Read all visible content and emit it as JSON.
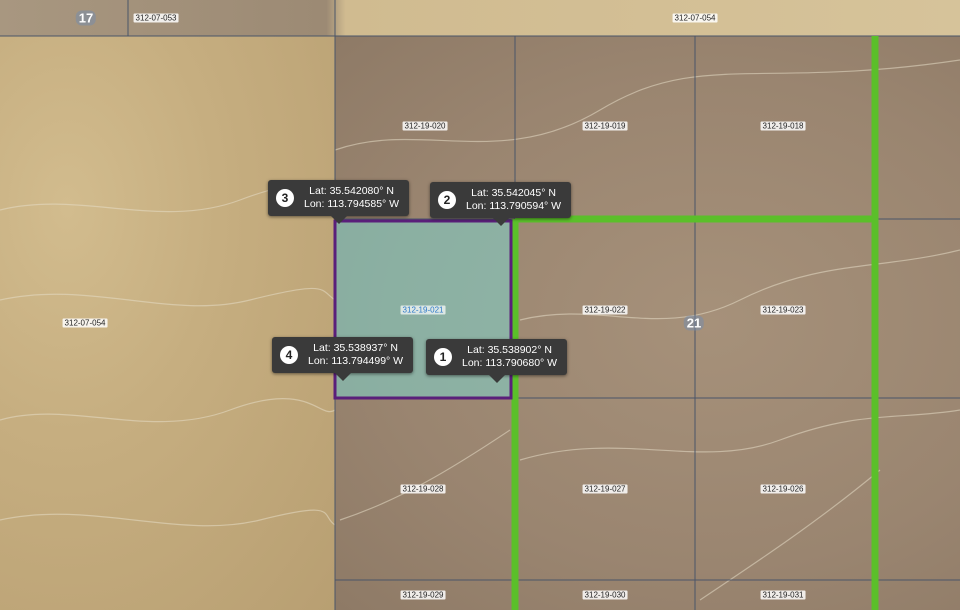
{
  "map": {
    "section_labels": [
      "17",
      "21"
    ],
    "selected_parcel": "312-19-021",
    "parcel_labels": [
      "312-07-053",
      "312-07-054",
      "312-19-020",
      "312-19-019",
      "312-19-018",
      "312-19-021",
      "312-19-022",
      "312-19-023",
      "312-07-054",
      "312-19-028",
      "312-19-027",
      "312-19-026",
      "312-19-029",
      "312-19-030",
      "312-19-031"
    ],
    "colors": {
      "selected_fill": "#7fd4cc",
      "selected_outline": "#5a1f7a",
      "road": "#5bbf2a",
      "parcel_line": "#4a5568",
      "callout_bg": "#3a3a3a"
    },
    "points": [
      {
        "num": "1",
        "lat": "Lat: 35.538902° N",
        "lon": "Lon: 113.790680° W"
      },
      {
        "num": "2",
        "lat": "Lat: 35.542045° N",
        "lon": "Lon: 113.790594° W"
      },
      {
        "num": "3",
        "lat": "Lat: 35.542080° N",
        "lon": "Lon: 113.794585° W"
      },
      {
        "num": "4",
        "lat": "Lat: 35.538937° N",
        "lon": "Lon: 113.794499° W"
      }
    ]
  }
}
